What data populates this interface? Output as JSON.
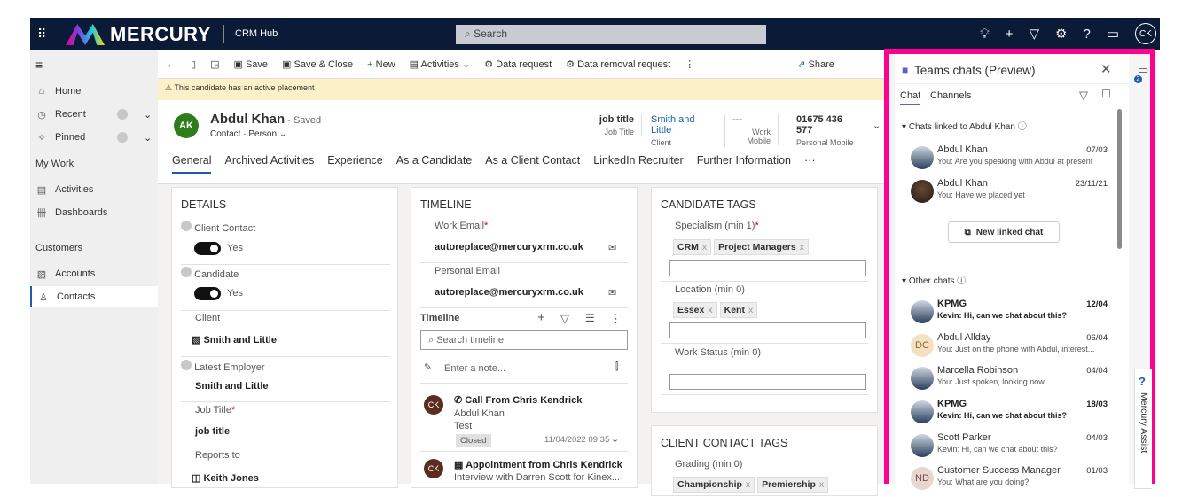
{
  "topbar": {
    "brand": "MERCURY",
    "app": "CRM Hub",
    "search_placeholder": "Search",
    "user_initials": "CK"
  },
  "sidebar": {
    "items": [
      {
        "label": "Home"
      },
      {
        "label": "Recent"
      },
      {
        "label": "Pinned"
      }
    ],
    "my_work": "My Work",
    "work_items": [
      {
        "label": "Activities"
      },
      {
        "label": "Dashboards"
      }
    ],
    "customers": "Customers",
    "customer_items": [
      {
        "label": "Accounts"
      },
      {
        "label": "Contacts"
      }
    ]
  },
  "cmdbar": {
    "save": "Save",
    "save_close": "Save & Close",
    "new": "New",
    "activities": "Activities",
    "data_request": "Data request",
    "data_removal": "Data removal request",
    "share": "Share"
  },
  "banner": "This candidate has an active placement",
  "record": {
    "initials": "AK",
    "name": "Abdul Khan",
    "saved": "- Saved",
    "type": "Contact · Person",
    "summary": [
      {
        "value": "job title",
        "label": "Job Title"
      },
      {
        "value": "Smith and Little",
        "label": "Client"
      },
      {
        "value": "---",
        "label": "Work Mobile"
      },
      {
        "value": "01675 436 577",
        "label": "Personal Mobile"
      }
    ],
    "tabs": [
      "General",
      "Archived Activities",
      "Experience",
      "As a Candidate",
      "As a Client Contact",
      "LinkedIn Recruiter",
      "Further Information",
      "···"
    ]
  },
  "details": {
    "title": "DETAILS",
    "client_contact": "Client Contact",
    "client_contact_val": "Yes",
    "candidate": "Candidate",
    "candidate_val": "Yes",
    "client": "Client",
    "client_val": "Smith and Little",
    "latest_employer": "Latest Employer",
    "latest_employer_val": "Smith and Little",
    "job_title": "Job Title",
    "job_title_val": "job title",
    "reports_to": "Reports to",
    "reports_to_val": "Keith Jones"
  },
  "timeline": {
    "title": "TIMELINE",
    "work_email": "Work Email",
    "work_email_val": "autoreplace@mercuryxrm.co.uk",
    "personal_email": "Personal Email",
    "personal_email_val": "autoreplace@mercuryxrm.co.uk",
    "timeline_label": "Timeline",
    "search_placeholder": "Search timeline",
    "note_placeholder": "Enter a note...",
    "entries": [
      {
        "initials": "CK",
        "title": "Call From Chris Kendrick",
        "line1": "Abdul Khan",
        "line2": "Test",
        "status": "Closed",
        "date": "11/04/2022 09:35"
      },
      {
        "initials": "CK",
        "title": "Appointment from Chris Kendrick",
        "line1": "Interview with Darren Scott for Kinex..."
      }
    ]
  },
  "candidate_tags": {
    "title": "CANDIDATE TAGS",
    "specialism": "Specialism (min 1)",
    "specialism_tags": [
      "CRM",
      "Project Managers"
    ],
    "location": "Location (min 0)",
    "location_tags": [
      "Essex",
      "Kent"
    ],
    "work_status": "Work Status (min 0)"
  },
  "client_tags": {
    "title": "CLIENT CONTACT TAGS",
    "grading": "Grading (min 0)",
    "grading_tags": [
      "Championship",
      "Premiership"
    ]
  },
  "teams": {
    "title": "Teams chats (Preview)",
    "tab_chat": "Chat",
    "tab_channels": "Channels",
    "linked_header": "Chats linked to Abdul Khan",
    "new_linked": "New linked chat",
    "other_header": "Other chats",
    "badge": "2",
    "assist": "Mercury Assist",
    "linked": [
      {
        "name": "Abdul Khan",
        "date": "07/03",
        "msg": "You: Are you speaking with Abdul at present"
      },
      {
        "name": "Abdul Khan",
        "date": "23/11/21",
        "msg": "You: Have we placed yet"
      }
    ],
    "other": [
      {
        "name": "KPMG",
        "date": "12/04",
        "msg": "Kevin: Hi, can we chat about this?",
        "bold": true
      },
      {
        "name": "Abdul Allday",
        "initials": "DC",
        "date": "06/04",
        "msg": "You: Just on the phone with Abdul, interest..."
      },
      {
        "name": "Marcella Robinson",
        "date": "04/04",
        "msg": "You: Just spoken, looking now."
      },
      {
        "name": "KPMG",
        "date": "18/03",
        "msg": "Kevin: Hi, can we chat about this?",
        "bold": true
      },
      {
        "name": "Scott Parker",
        "date": "04/03",
        "msg": "Kevin: Hi, can we chat about this?"
      },
      {
        "name": "Customer Success Manager",
        "initials": "ND",
        "date": "01/03",
        "msg": "You: What are you doing?"
      }
    ]
  },
  "colors": {
    "header": "#0b1a36",
    "highlight": "#ff0090",
    "accent": "#1a5dab",
    "avatar_green": "#2e7d1a"
  }
}
